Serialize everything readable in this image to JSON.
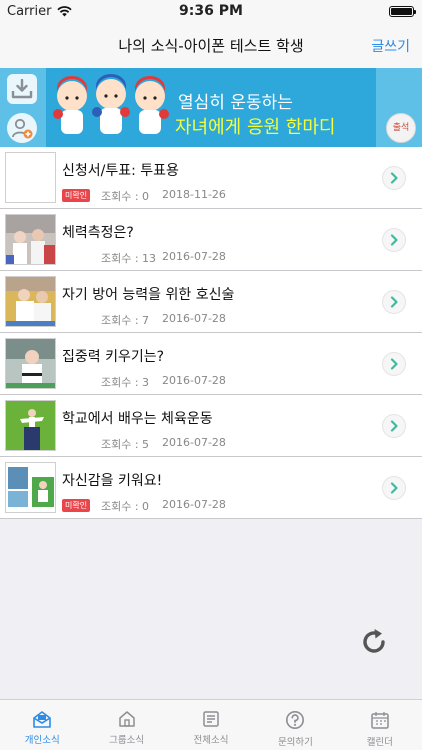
{
  "status_bar": {
    "carrier": "Carrier",
    "time": "9:36 PM",
    "battery_level": 1.0
  },
  "nav": {
    "title": "나의 소식-아이폰 테스트 학생",
    "action": "글쓰기"
  },
  "banner": {
    "line1": "열심히 운동하는",
    "line2": "자녀에게 응원 한마디",
    "attendance_label": "출석",
    "colors": {
      "main": "#2ea7da",
      "side": "#5fc0e7",
      "highlight": "#f4ff3a"
    }
  },
  "posts": [
    {
      "title": "신청서/투표: 투표용",
      "views": "조회수 : 0",
      "date": "2018-11-26",
      "unread": "미확인",
      "thumb": "blank-thumbnail"
    },
    {
      "title": "체력측정은?",
      "views": "조회수 : 13",
      "date": "2016-07-28",
      "unread": "",
      "thumb": "taekwondo-class-photo"
    },
    {
      "title": "자기 방어 능력을 위한 호신술",
      "views": "조회수 : 7",
      "date": "2016-07-28",
      "unread": "",
      "thumb": "self-defense-photo"
    },
    {
      "title": "집중력 키우기는?",
      "views": "조회수 : 3",
      "date": "2016-07-28",
      "unread": "",
      "thumb": "concentration-photo"
    },
    {
      "title": "학교에서 배우는 체육운동",
      "views": "조회수 : 5",
      "date": "2016-07-28",
      "unread": "",
      "thumb": "jump-kick-photo"
    },
    {
      "title": "자신감을 키워요!",
      "views": "조회수 : 0",
      "date": "2016-07-28",
      "unread": "미확인",
      "thumb": "confidence-collage"
    }
  ],
  "tabs": [
    {
      "label": "개인소식",
      "icon": "envelope-icon",
      "active": true
    },
    {
      "label": "그룹소식",
      "icon": "house-icon",
      "active": false
    },
    {
      "label": "전체소식",
      "icon": "document-icon",
      "active": false
    },
    {
      "label": "문의하기",
      "icon": "question-icon",
      "active": false
    },
    {
      "label": "캘린더",
      "icon": "calendar-icon",
      "active": false
    }
  ],
  "accent_color": "#2f8be6"
}
